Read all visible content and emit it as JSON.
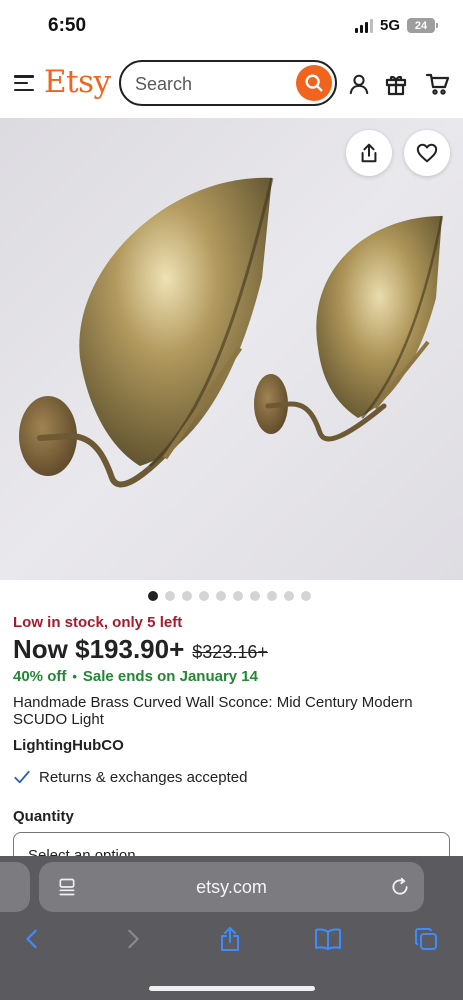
{
  "status_bar": {
    "time": "6:50",
    "network": "5G",
    "battery": "24"
  },
  "header": {
    "logo": "Etsy",
    "search_placeholder": "Search",
    "brand_color": "#f1641e"
  },
  "gallery": {
    "image_count": 10,
    "active_index": 0
  },
  "product": {
    "stock_text": "Low in stock, only 5 left",
    "price_now": "Now $193.90+",
    "price_original": "$323.16+",
    "discount": "40% off",
    "separator": "•",
    "sale_end": "Sale ends on January 14",
    "title": "Handmade Brass Curved Wall Sconce: Mid Century Modern SCUDO Light",
    "shop_name": "LightingHubCO",
    "returns_text": "Returns & exchanges accepted",
    "quantity_label": "Quantity",
    "quantity_value": "Select an option"
  },
  "browser": {
    "url": "etsy.com"
  },
  "colors": {
    "stock": "#a61a2e",
    "discount": "#258635",
    "browser_bar": "#5b5b5f"
  }
}
